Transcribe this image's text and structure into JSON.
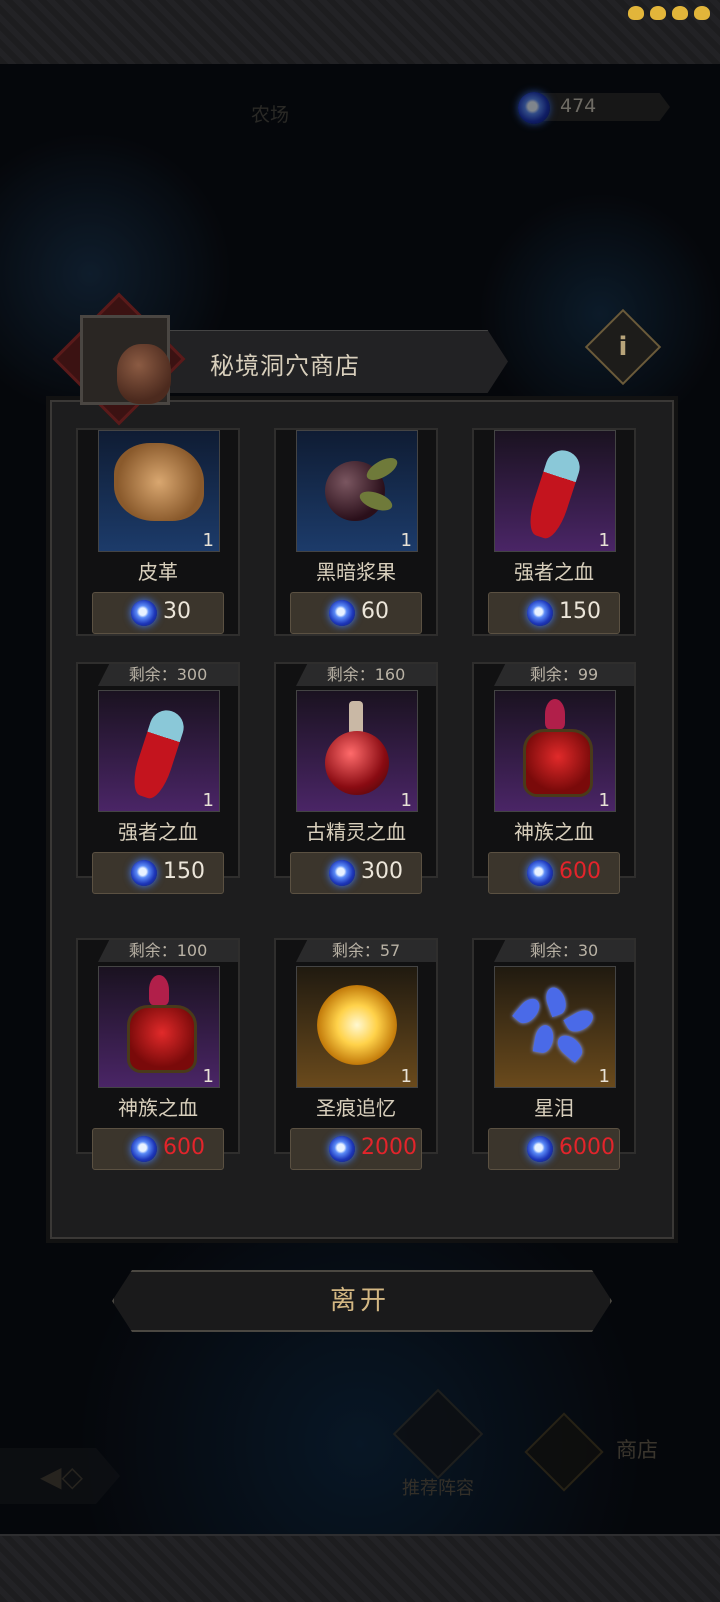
{
  "background": {
    "area_label": "农场",
    "currency_amount": "474",
    "nav": {
      "recommend_label": "推荐阵容",
      "shop_label": "商店"
    }
  },
  "shop": {
    "title": "秘境洞穴商店",
    "info_icon": "i",
    "remaining_prefix": "剩余：",
    "leave_label": "离开",
    "items": [
      {
        "name": "皮革",
        "qty": "1",
        "price": "30",
        "remaining": null,
        "tier": "blue",
        "icon": "leather-icon",
        "affordable": true
      },
      {
        "name": "黑暗浆果",
        "qty": "1",
        "price": "60",
        "remaining": null,
        "tier": "blue",
        "icon": "dark-berry-icon",
        "affordable": true
      },
      {
        "name": "强者之血",
        "qty": "1",
        "price": "150",
        "remaining": null,
        "tier": "purple",
        "icon": "blood-vial-icon",
        "affordable": true
      },
      {
        "name": "强者之血",
        "qty": "1",
        "price": "150",
        "remaining": "剩余：300",
        "tier": "purple",
        "icon": "blood-vial-icon",
        "affordable": true
      },
      {
        "name": "古精灵之血",
        "qty": "1",
        "price": "300",
        "remaining": "剩余：160",
        "tier": "purple",
        "icon": "elf-blood-flask-icon",
        "affordable": true
      },
      {
        "name": "神族之血",
        "qty": "1",
        "price": "600",
        "remaining": "剩余：99",
        "tier": "purple",
        "icon": "divine-blood-icon",
        "affordable": false
      },
      {
        "name": "神族之血",
        "qty": "1",
        "price": "600",
        "remaining": "剩余：100",
        "tier": "purple",
        "icon": "divine-blood-icon",
        "affordable": false
      },
      {
        "name": "圣痕追忆",
        "qty": "1",
        "price": "2000",
        "remaining": "剩余：57",
        "tier": "gold",
        "icon": "stigmata-memory-icon",
        "affordable": false
      },
      {
        "name": "星泪",
        "qty": "1",
        "price": "6000",
        "remaining": "剩余：30",
        "tier": "gold",
        "icon": "star-tear-icon",
        "affordable": false
      }
    ]
  },
  "colors": {
    "price_normal": "#ece6da",
    "price_unaffordable": "#e3242b",
    "accent_gold": "#d3b783"
  }
}
